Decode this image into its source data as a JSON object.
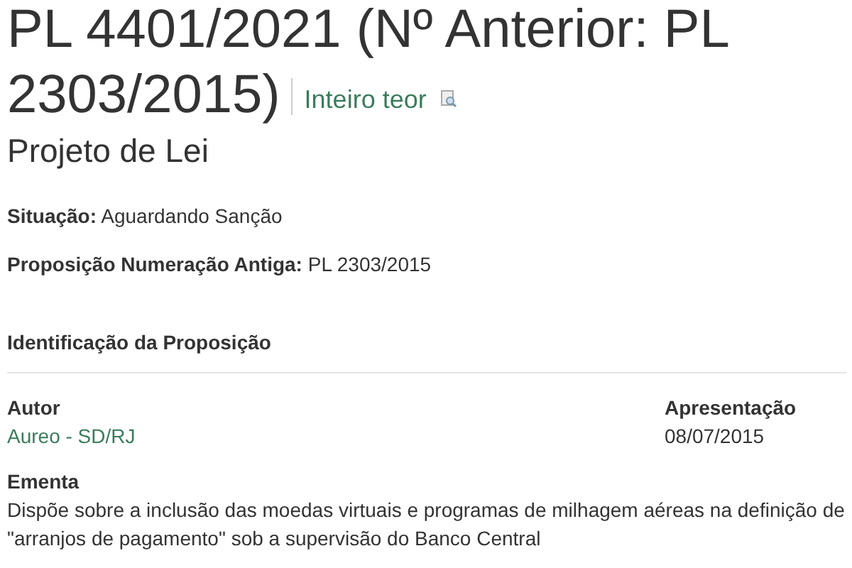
{
  "title_lines": [
    "PL 4401/2021 (Nº Anterior: PL",
    "2303/2015)"
  ],
  "full_text_link": "Inteiro teor",
  "type": "Projeto de Lei",
  "fields": [
    {
      "text": "**Situação:** Aguardando Sanção"
    },
    {
      "text": "**Proposição Numeração Antiga:** PL 2303/2015"
    }
  ],
  "section_title": "Identificação da Proposição",
  "author": {
    "label": "Autor",
    "value": "Aureo - SD/RJ"
  },
  "presentation": {
    "label": "Apresentação",
    "value": "08/07/2015"
  },
  "summary": {
    "label": "Ementa",
    "value": "Dispõe sobre a inclusão das moedas virtuais e programas de milhagem aéreas na definição de \"arranjos de pagamento\" sob a supervisão do Banco Central"
  }
}
